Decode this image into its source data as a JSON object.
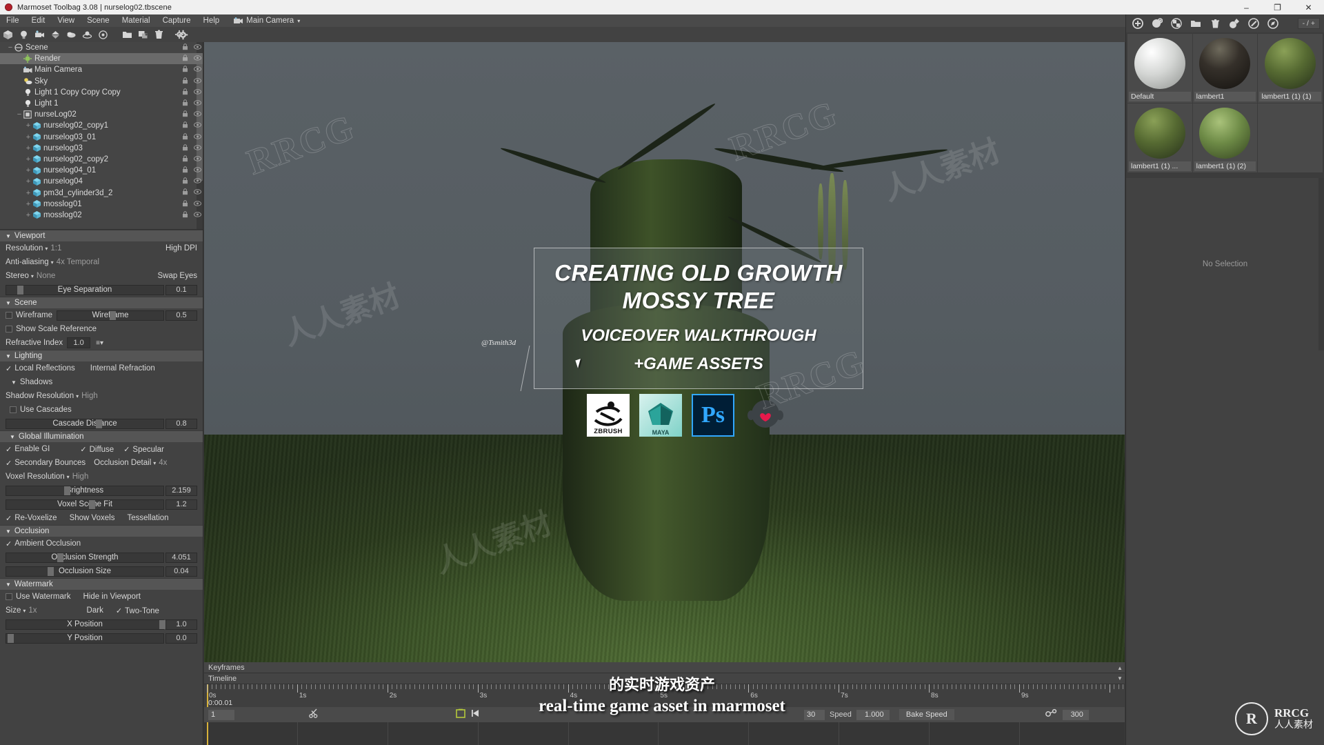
{
  "window": {
    "title": "Marmoset Toolbag 3.08  |  nurselog02.tbscene",
    "minimize": "–",
    "maximize": "❐",
    "restore": "❐",
    "close": "✕"
  },
  "menu": {
    "items": [
      "File",
      "Edit",
      "View",
      "Scene",
      "Material",
      "Capture",
      "Help"
    ],
    "camera_label": "Main Camera",
    "camera_caret": "▾"
  },
  "toolbar": {
    "icons": [
      "add-mesh-icon",
      "add-light-icon",
      "add-camera-icon",
      "add-sky-icon",
      "add-fog-icon",
      "add-turntable-icon",
      "add-target-icon",
      "open-folder-icon",
      "duplicate-icon",
      "delete-icon",
      "settings-gear-icon",
      "brush-icon"
    ]
  },
  "tree": {
    "nodes": [
      {
        "label": "Scene",
        "depth": 0,
        "expander": "−",
        "icon": "scene-icon",
        "selected": false
      },
      {
        "label": "Render",
        "depth": 1,
        "expander": "",
        "icon": "render-icon",
        "selected": true
      },
      {
        "label": "Main Camera",
        "depth": 1,
        "expander": "",
        "icon": "camera-icon",
        "selected": false
      },
      {
        "label": "Sky",
        "depth": 1,
        "expander": "",
        "icon": "sky-icon",
        "selected": false
      },
      {
        "label": "Light 1 Copy Copy Copy",
        "depth": 1,
        "expander": "",
        "icon": "light-icon",
        "selected": false
      },
      {
        "label": "Light 1",
        "depth": 1,
        "expander": "",
        "icon": "light-icon",
        "selected": false
      },
      {
        "label": "nurseLog02",
        "depth": 1,
        "expander": "−",
        "icon": "group-icon",
        "selected": false
      },
      {
        "label": "nurselog02_copy1",
        "depth": 2,
        "expander": "+",
        "icon": "mesh-icon",
        "selected": false
      },
      {
        "label": "nurselog03_01",
        "depth": 2,
        "expander": "+",
        "icon": "mesh-icon",
        "selected": false
      },
      {
        "label": "nurselog03",
        "depth": 2,
        "expander": "+",
        "icon": "mesh-icon",
        "selected": false
      },
      {
        "label": "nurselog02_copy2",
        "depth": 2,
        "expander": "+",
        "icon": "mesh-icon",
        "selected": false
      },
      {
        "label": "nurselog04_01",
        "depth": 2,
        "expander": "+",
        "icon": "mesh-icon",
        "selected": false
      },
      {
        "label": "nurselog04",
        "depth": 2,
        "expander": "+",
        "icon": "mesh-icon",
        "selected": false
      },
      {
        "label": "pm3d_cylinder3d_2",
        "depth": 2,
        "expander": "+",
        "icon": "mesh-icon",
        "selected": false
      },
      {
        "label": "mosslog01",
        "depth": 2,
        "expander": "+",
        "icon": "mesh-icon",
        "selected": false
      },
      {
        "label": "mosslog02",
        "depth": 2,
        "expander": "+",
        "icon": "mesh-icon",
        "selected": false
      }
    ]
  },
  "viewport_panel": {
    "header": "Viewport",
    "caret": "▼",
    "resolution_label": "Resolution",
    "resolution_value": "1:1",
    "high_dpi": "High DPI",
    "antialiasing_label": "Anti-aliasing",
    "antialiasing_value": "4x Temporal",
    "stereo_label": "Stereo",
    "stereo_value": "None",
    "swap_eyes": "Swap Eyes",
    "eye_separation_label": "Eye Separation",
    "eye_separation_value": "0.1"
  },
  "scene_panel": {
    "header": "Scene",
    "wireframe_label": "Wireframe",
    "wireframe_slider_label": "Wireframe",
    "wireframe_value": "0.5",
    "show_scale_reference": "Show Scale Reference",
    "refractive_index_label": "Refractive Index",
    "refractive_index_value": "1.0",
    "list_caret": "≡▾"
  },
  "lighting_panel": {
    "header": "Lighting",
    "local_reflections": "Local Reflections",
    "internal_refraction": "Internal Refraction",
    "shadows_header": "Shadows",
    "shadow_resolution_label": "Shadow Resolution",
    "shadow_resolution_value": "High",
    "use_cascades": "Use Cascades",
    "cascade_distance_label": "Cascade Distance",
    "cascade_distance_value": "0.8"
  },
  "gi_panel": {
    "header": "Global Illumination",
    "enable_gi": "Enable GI",
    "diffuse": "Diffuse",
    "specular": "Specular",
    "secondary_bounces": "Secondary Bounces",
    "occlusion_detail_label": "Occlusion Detail",
    "occlusion_detail_value": "4x",
    "voxel_resolution_label": "Voxel Resolution",
    "voxel_resolution_value": "High",
    "brightness_label": "Brightness",
    "brightness_value": "2.159",
    "voxel_scene_fit_label": "Voxel Scene Fit",
    "voxel_scene_fit_value": "1.2",
    "re_voxelize": "Re-Voxelize",
    "show_voxels": "Show Voxels",
    "tessellation": "Tessellation"
  },
  "occlusion_panel": {
    "header": "Occlusion",
    "ambient_occlusion": "Ambient Occlusion",
    "occlusion_strength_label": "Occlusion Strength",
    "occlusion_strength_value": "4.051",
    "occlusion_size_label": "Occlusion Size",
    "occlusion_size_value": "0.04"
  },
  "watermark_panel": {
    "header": "Watermark",
    "use_watermark": "Use Watermark",
    "hide_in_viewport": "Hide in Viewport",
    "size_label": "Size",
    "size_value": "1x",
    "dark": "Dark",
    "two_tone": "Two-Tone",
    "x_position_label": "X Position",
    "x_position_value": "1.0",
    "y_position_label": "Y Position",
    "y_position_value": "0.0"
  },
  "overlay_card": {
    "title_line1": "CREATING OLD GROWTH",
    "title_line2": "MOSSY TREE",
    "sub_line1": "VOICEOVER WALKTHROUGH",
    "sub_line2": "+GAME ASSETS",
    "handle": "@Tsmith3d",
    "logos": [
      {
        "name": "zbrush-logo",
        "label": "ZBRUSH"
      },
      {
        "name": "maya-logo",
        "label": "MAYA"
      },
      {
        "name": "photoshop-logo",
        "label": "Ps"
      },
      {
        "name": "marmoset-logo",
        "label": ""
      }
    ]
  },
  "timeline": {
    "keyframes_label": "Keyframes",
    "timeline_label": "Timeline",
    "ticks": [
      "0s",
      "1s",
      "2s",
      "3s",
      "4s",
      "5s",
      "6s",
      "7s",
      "8s",
      "9s"
    ],
    "current_time": "0:00.01",
    "frame_value": "1",
    "fps_value": "30",
    "speed_label": "Speed",
    "speed_value": "1.000",
    "bake_speed_label": "Bake Speed",
    "link_icon": "link-icon",
    "end_frame_value": "300",
    "scissors_icon": "scissors-icon",
    "loop_icon": "loop-icon",
    "prev_key_icon": "prev-keyframe-icon"
  },
  "subtitles": {
    "chinese": "的实时游戏资产",
    "english": "real-time game asset in marmoset"
  },
  "materials": {
    "toolbar_icons": [
      "add-material-icon",
      "duplicate-material-icon",
      "checker-icon",
      "folder-icon",
      "trash-icon",
      "pick-material-icon",
      "edit-material-icon",
      "browse-material-icon"
    ],
    "count_label": "- / +",
    "items": [
      {
        "name": "Default",
        "color": "#c9cbc9",
        "type": "default-sphere"
      },
      {
        "name": "lambert1",
        "color": "#2a2620",
        "type": "bark-sphere"
      },
      {
        "name": "lambert1 (1) (1)",
        "color": "#58643c",
        "type": "moss-sphere"
      },
      {
        "name": "lambert1 (1) ...",
        "color": "#5d6b3e",
        "type": "moss-sphere"
      },
      {
        "name": "lambert1 (1) (2)",
        "color": "#7d9155",
        "type": "leaf-sphere"
      }
    ],
    "no_selection": "No Selection"
  },
  "branding": {
    "rrcg_mark": "R",
    "rrcg_text": "RRCG",
    "rrcg_cn": "人人素材"
  },
  "colors": {
    "accent": "#d8b23a",
    "panel": "#424242",
    "panel_dark": "#3a3a3a",
    "header": "#555555",
    "selection": "#6a6a6a",
    "text": "#d8d8d8"
  }
}
